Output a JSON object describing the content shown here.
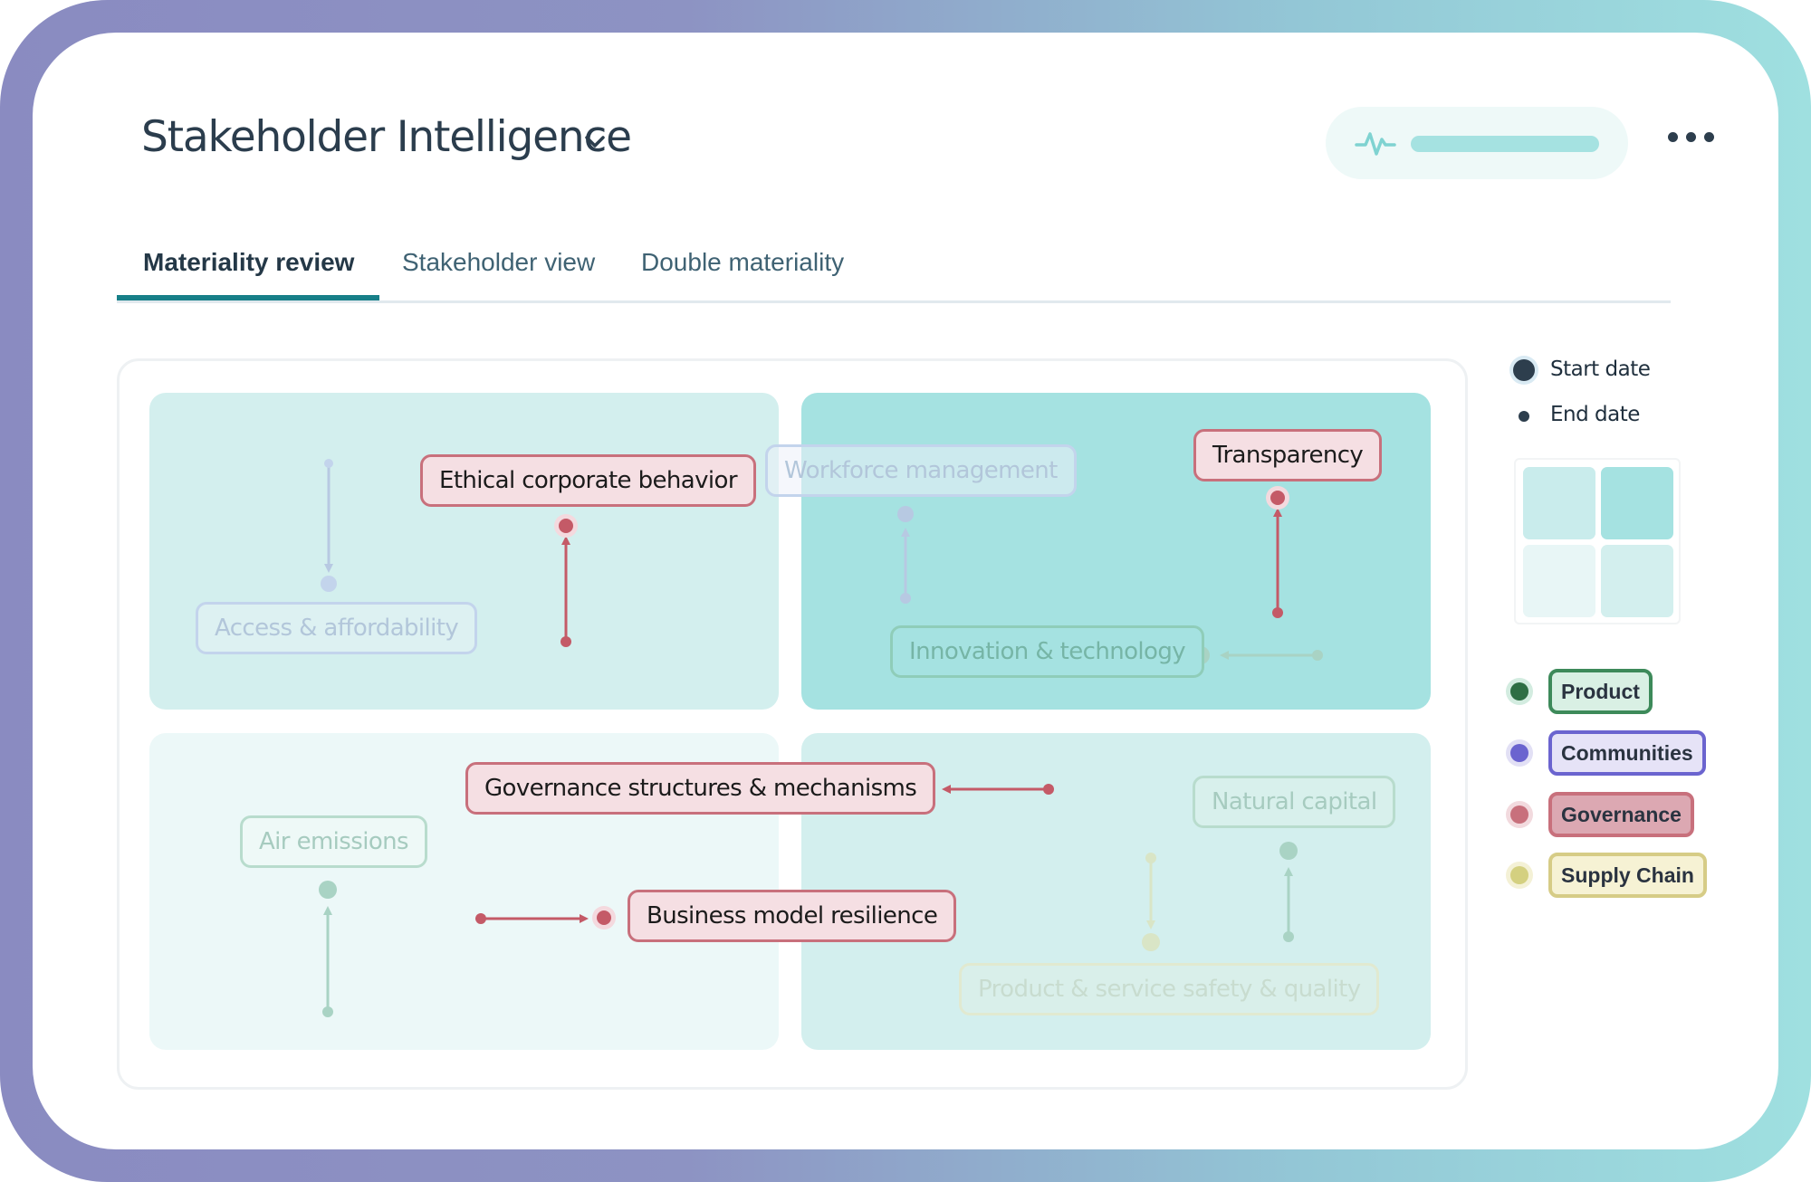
{
  "header": {
    "title": "Stakeholder Intelligence",
    "title_menu_icon": "chevron-down-icon",
    "status_icon": "pulse-icon",
    "more_icon": "more-horizontal-icon"
  },
  "tabs": [
    {
      "label": "Materiality review",
      "active": true
    },
    {
      "label": "Stakeholder view",
      "active": false
    },
    {
      "label": "Double materiality",
      "active": false
    }
  ],
  "matrix": {
    "topics": [
      {
        "label": "Ethical corporate behavior",
        "category": "Governance",
        "highlighted": true
      },
      {
        "label": "Transparency",
        "category": "Governance",
        "highlighted": true
      },
      {
        "label": "Governance structures & mechanisms",
        "category": "Governance",
        "highlighted": true
      },
      {
        "label": "Business model resilience",
        "category": "Governance",
        "highlighted": true
      },
      {
        "label": "Workforce management",
        "category": "Communities",
        "highlighted": false
      },
      {
        "label": "Access & affordability",
        "category": "Communities",
        "highlighted": false
      },
      {
        "label": "Innovation & technology",
        "category": "Product",
        "highlighted": false
      },
      {
        "label": "Air emissions",
        "category": "Product",
        "highlighted": false
      },
      {
        "label": "Natural capital",
        "category": "Product",
        "highlighted": false
      },
      {
        "label": "Product & service safety & quality",
        "category": "Supply Chain",
        "highlighted": false
      }
    ]
  },
  "legend": {
    "start_date": "Start date",
    "end_date": "End date",
    "quadrant_colors": [
      "#d3efee",
      "#a5e2e1",
      "#ecf8f8",
      "#d3efee"
    ],
    "categories": [
      {
        "label": "Product",
        "color": "#2e6e44",
        "fill": "#d9f0e4",
        "border": "#3d8a5a"
      },
      {
        "label": "Communities",
        "color": "#6b64cf",
        "fill": "#e6e3f7",
        "border": "#6b64cf"
      },
      {
        "label": "Governance",
        "color": "#c8707c",
        "fill": "#dca8b2",
        "border": "#c8707c"
      },
      {
        "label": "Supply Chain",
        "color": "#d4d080",
        "fill": "#f6f2d4",
        "border": "#d6cc86"
      }
    ]
  }
}
